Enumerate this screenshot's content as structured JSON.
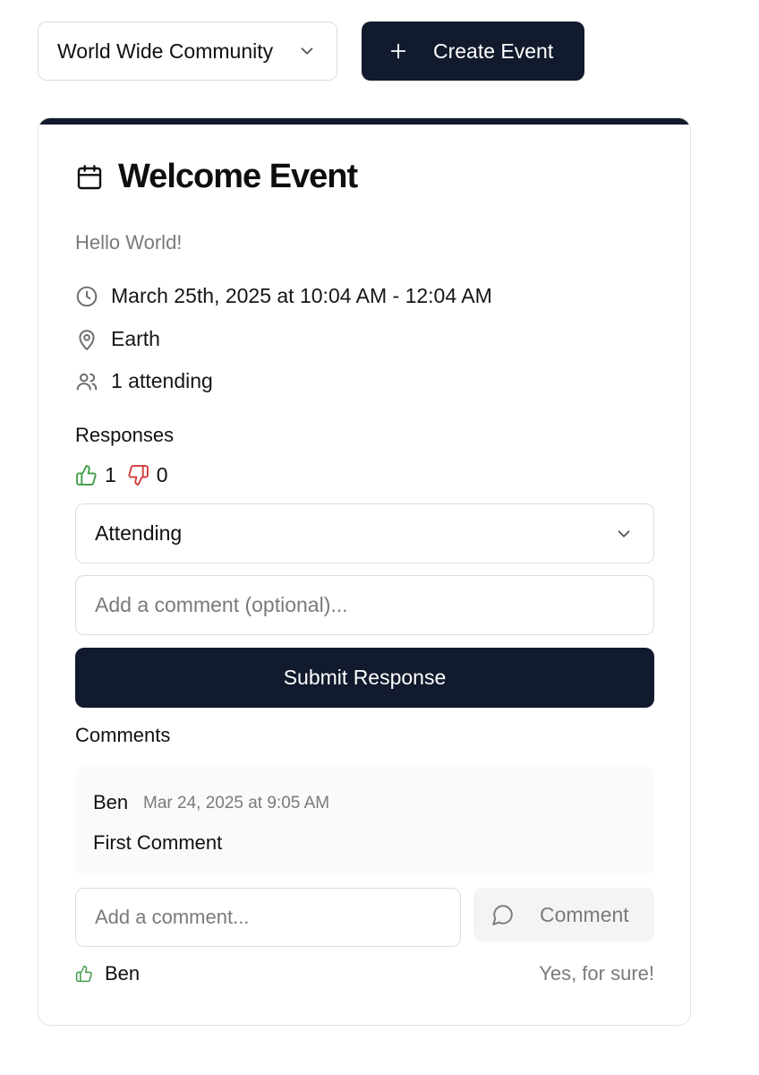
{
  "header": {
    "community_select": {
      "value": "World Wide Community",
      "icon": "chevron-down-icon"
    },
    "create_button": {
      "label": "Create Event",
      "icon": "plus-icon"
    }
  },
  "event": {
    "icon": "calendar-icon",
    "title": "Welcome Event",
    "description": "Hello World!",
    "datetime": "March 25th, 2025 at 10:04 AM - 12:04 AM",
    "location": "Earth",
    "attending": "1 attending"
  },
  "responses": {
    "label": "Responses",
    "thumbs_up_count": "1",
    "thumbs_down_count": "0",
    "select_value": "Attending",
    "comment_placeholder": "Add a comment (optional)...",
    "submit_label": "Submit Response"
  },
  "comments": {
    "label": "Comments",
    "items": [
      {
        "author": "Ben",
        "time": "Mar 24, 2025 at 9:05 AM",
        "text": "First Comment"
      }
    ],
    "input_placeholder": "Add a comment...",
    "button_label": "Comment"
  },
  "attendees": [
    {
      "name": "Ben",
      "response": "Yes, for sure!"
    }
  ],
  "colors": {
    "primary": "#121a2d",
    "thumbs_up": "#3f9d4a",
    "thumbs_down": "#d23a3a",
    "muted_text": "#7a7a7a"
  }
}
